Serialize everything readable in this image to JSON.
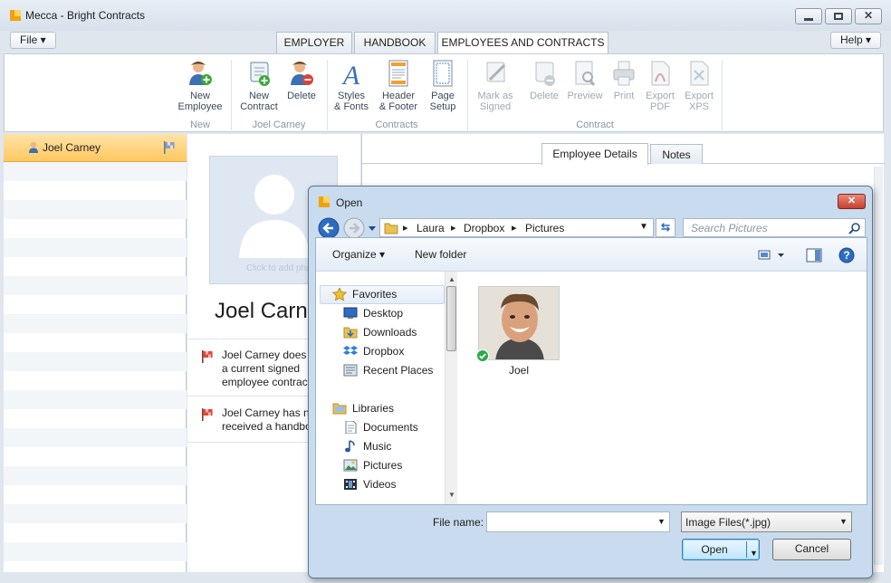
{
  "window": {
    "title": "Mecca - Bright Contracts"
  },
  "menu": {
    "file_label": "File ▾",
    "help_label": "Help ▾"
  },
  "tabs": [
    {
      "label": "EMPLOYER",
      "active": false
    },
    {
      "label": "HANDBOOK",
      "active": false
    },
    {
      "label": "EMPLOYEES AND CONTRACTS",
      "active": true
    }
  ],
  "ribbon": {
    "groups": [
      {
        "label": "New",
        "buttons": [
          {
            "label": "New Employee",
            "icon": "new-employee-icon",
            "enabled": true
          }
        ]
      },
      {
        "label": "Joel Carney",
        "buttons": [
          {
            "label": "New Contract",
            "icon": "new-contract-icon",
            "enabled": true
          },
          {
            "label": "Delete",
            "icon": "delete-employee-icon",
            "enabled": true
          }
        ]
      },
      {
        "label": "Contracts",
        "buttons": [
          {
            "label": "Styles & Fonts",
            "icon": "styles-fonts-icon",
            "enabled": true
          },
          {
            "label": "Header & Footer",
            "icon": "header-footer-icon",
            "enabled": true
          },
          {
            "label": "Page Setup",
            "icon": "page-setup-icon",
            "enabled": true
          }
        ]
      },
      {
        "label": "Contract",
        "buttons": [
          {
            "label": "Mark as Signed",
            "icon": "mark-signed-icon",
            "enabled": false
          },
          {
            "label": "Delete",
            "icon": "delete-contract-icon",
            "enabled": false
          },
          {
            "label": "Preview",
            "icon": "preview-icon",
            "enabled": false
          },
          {
            "label": "Print",
            "icon": "print-icon",
            "enabled": false
          },
          {
            "label": "Export PDF",
            "icon": "export-pdf-icon",
            "enabled": false
          },
          {
            "label": "Export XPS",
            "icon": "export-xps-icon",
            "enabled": false
          }
        ]
      }
    ]
  },
  "employee_list": {
    "selected": "Joel Carney"
  },
  "employee": {
    "name": "Joel Carn",
    "photo_hint": "Click to add photo",
    "warnings": [
      {
        "line1": "Joel Carney does n",
        "line2": "a current signed",
        "line3": "employee contrac"
      },
      {
        "line1": "Joel Carney has no",
        "line2": "received a handbo",
        "line3": ""
      }
    ]
  },
  "detail_tabs": [
    {
      "label": "Employee Details",
      "active": true
    },
    {
      "label": "Notes",
      "active": false
    }
  ],
  "dialog": {
    "title": "Open",
    "breadcrumb": [
      "Laura",
      "Dropbox",
      "Pictures"
    ],
    "search_placeholder": "Search Pictures",
    "toolbar": {
      "organize": "Organize ▾",
      "new_folder": "New folder"
    },
    "favorites_label": "Favorites",
    "favorites": [
      "Desktop",
      "Downloads",
      "Dropbox",
      "Recent Places"
    ],
    "libraries_label": "Libraries",
    "libraries": [
      "Documents",
      "Music",
      "Pictures",
      "Videos"
    ],
    "files": [
      {
        "name": "Joel"
      }
    ],
    "file_name_label": "File name:",
    "file_name_value": "",
    "file_type": "Image Files(*.jpg)",
    "open_label": "Open",
    "cancel_label": "Cancel"
  },
  "colors": {
    "accent": "#ffc860",
    "title_bg": "#d7e1ec",
    "close_red": "#c7402f"
  }
}
